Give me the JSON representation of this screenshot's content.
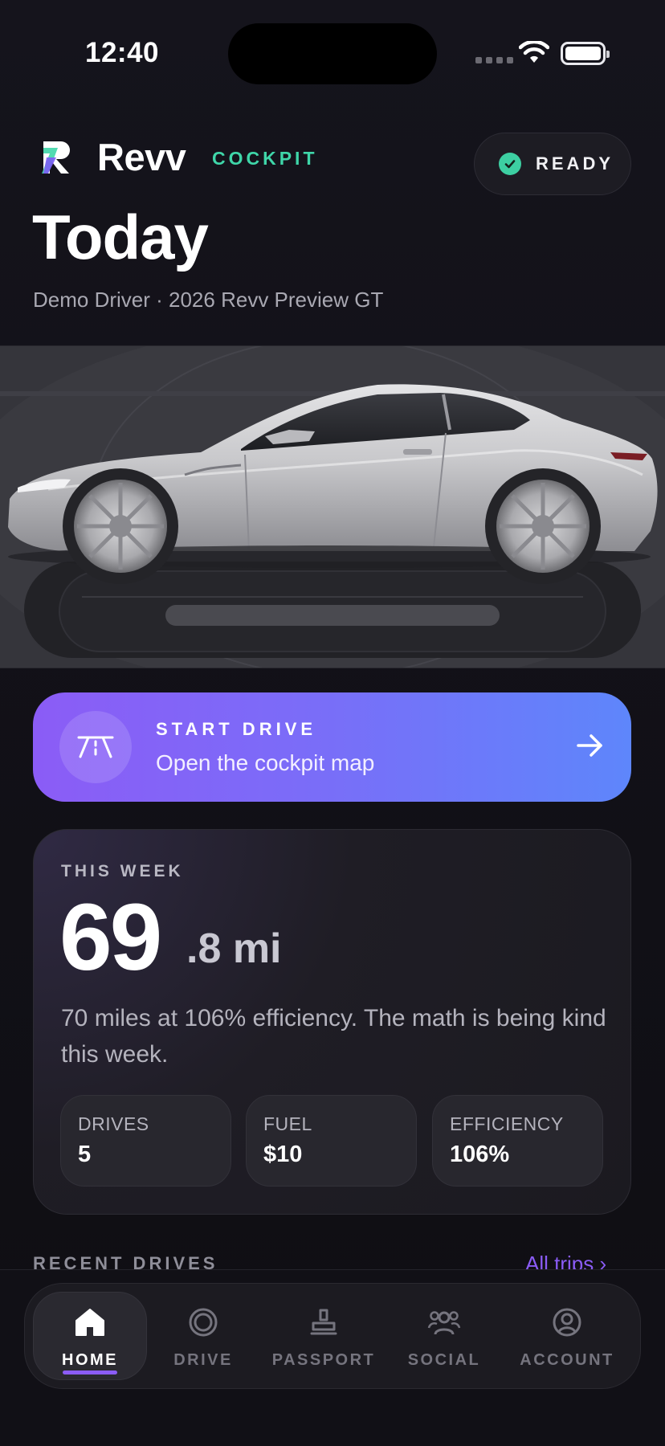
{
  "status_bar": {
    "time": "12:40"
  },
  "brand": {
    "name": "Revv",
    "subtitle": "COCKPIT"
  },
  "ready_badge": {
    "label": "READY"
  },
  "header": {
    "title": "Today",
    "subtitle": "Demo Driver · 2026 Revv Preview GT"
  },
  "start_drive": {
    "title": "START DRIVE",
    "subtitle": "Open the cockpit map"
  },
  "this_week": {
    "label": "THIS WEEK",
    "miles_whole": "69",
    "miles_fraction": ".8 mi",
    "summary": "70 miles at 106% efficiency. The math is being kind this week.",
    "stats": [
      {
        "label": "DRIVES",
        "value": "5"
      },
      {
        "label": "FUEL",
        "value": "$10"
      },
      {
        "label": "EFFICIENCY",
        "value": "106%"
      }
    ]
  },
  "recent_drives": {
    "label": "RECENT DRIVES",
    "link": "All trips  ›"
  },
  "tabs": [
    {
      "label": "HOME",
      "icon": "home-icon",
      "active": true
    },
    {
      "label": "DRIVE",
      "icon": "drive-ring-icon",
      "active": false
    },
    {
      "label": "PASSPORT",
      "icon": "stamp-icon",
      "active": false
    },
    {
      "label": "SOCIAL",
      "icon": "people-icon",
      "active": false
    },
    {
      "label": "ACCOUNT",
      "icon": "account-icon",
      "active": false
    }
  ],
  "colors": {
    "accent": "#8b5cf6",
    "ready_green": "#3dcfa2",
    "gradient_end": "#5e86fb"
  }
}
